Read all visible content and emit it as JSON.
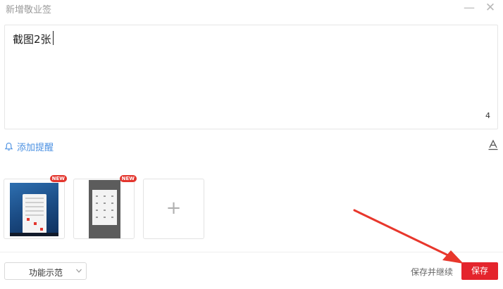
{
  "window": {
    "title": "新增敬业签",
    "minimize_icon": "minimize-icon",
    "close_icon": "close-icon"
  },
  "editor": {
    "content": "截图2张",
    "char_count": "4"
  },
  "reminder": {
    "label": "添加提醒",
    "icon": "bell-icon"
  },
  "toolbar": {
    "format_icon": "text-format-icon"
  },
  "attachments": {
    "images": [
      {
        "badge": "NEW",
        "description_icon": "desktop-screenshot"
      },
      {
        "badge": "NEW",
        "description_icon": "phone-screenshot"
      }
    ],
    "add_label": "+"
  },
  "footer": {
    "demo_select_value": "功能示范",
    "save_continue_label": "保存并继续",
    "save_label": "保存"
  },
  "colors": {
    "accent_red": "#e4242c",
    "link_blue": "#4a90e2",
    "annotation_arrow": "#e8372c"
  }
}
